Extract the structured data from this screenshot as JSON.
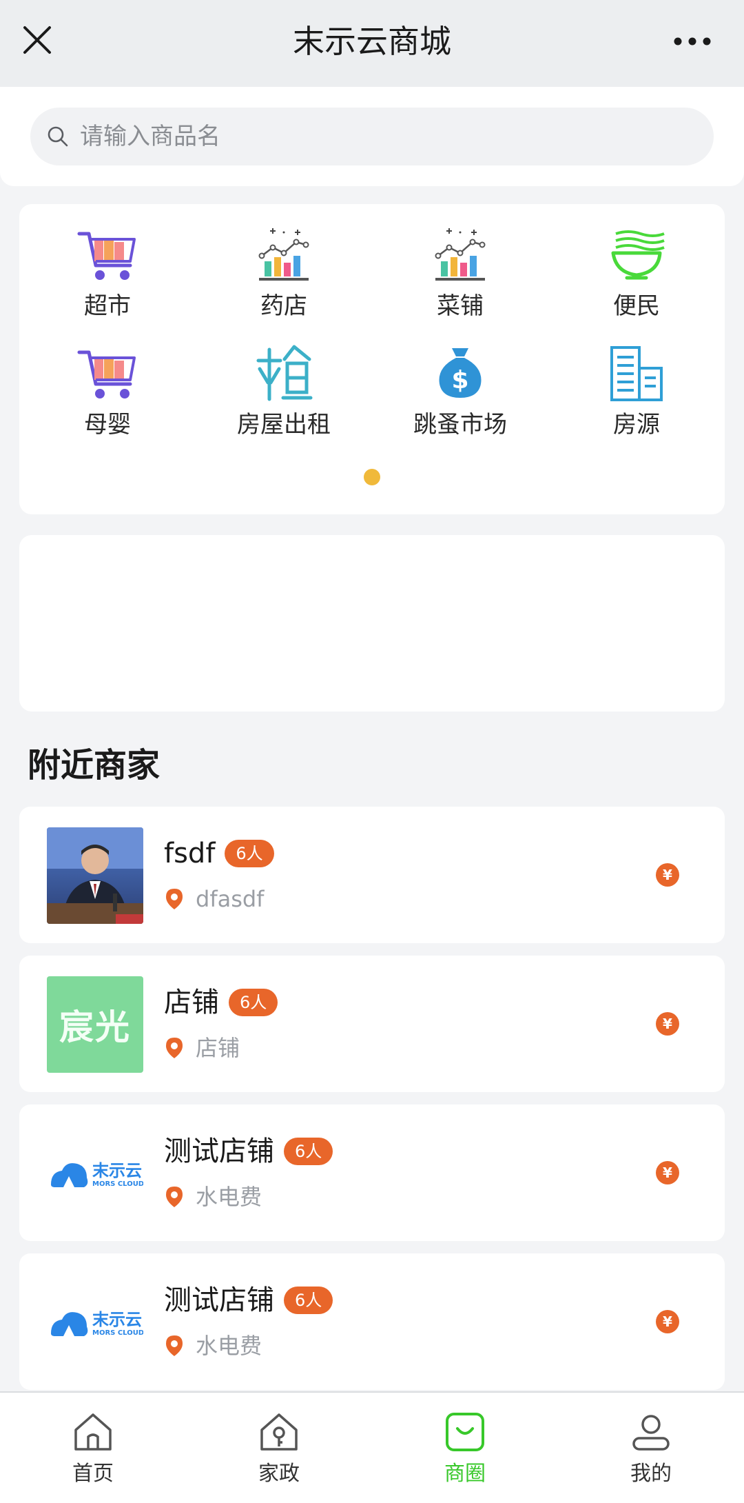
{
  "app": {
    "title": "末示云商城"
  },
  "search": {
    "placeholder": "请输入商品名",
    "value": ""
  },
  "categories": [
    {
      "label": "超市",
      "icon": "shopping-cart-icon"
    },
    {
      "label": "药店",
      "icon": "bar-chart-icon"
    },
    {
      "label": "菜铺",
      "icon": "bar-chart-icon"
    },
    {
      "label": "便民",
      "icon": "noodle-bowl-icon"
    },
    {
      "label": "母婴",
      "icon": "shopping-cart-icon"
    },
    {
      "label": "房屋出租",
      "icon": "rent-icon"
    },
    {
      "label": "跳蚤市场",
      "icon": "money-bag-icon"
    },
    {
      "label": "房源",
      "icon": "buildings-icon"
    }
  ],
  "carousel": {
    "active_page": 1,
    "page_count": 1,
    "dot_color": "#f0b93a"
  },
  "nearby": {
    "title": "附近商家",
    "shops": [
      {
        "name": "fsdf",
        "badge": "6人",
        "address": "dfasdf",
        "thumb": "portrait-photo",
        "price_icon": "¥"
      },
      {
        "name": "店铺",
        "badge": "6人",
        "address": "店铺",
        "thumb": "text-logo",
        "thumb_text": "宸光",
        "price_icon": "¥"
      },
      {
        "name": "测试店铺",
        "badge": "6人",
        "address": "水电费",
        "thumb": "mars-cloud-logo",
        "logo_text": "末示云",
        "logo_sub": "MORS CLOUD",
        "price_icon": "¥"
      },
      {
        "name": "测试店铺",
        "badge": "6人",
        "address": "水电费",
        "thumb": "mars-cloud-logo",
        "logo_text": "末示云",
        "logo_sub": "MORS CLOUD",
        "price_icon": "¥"
      }
    ]
  },
  "tabbar": {
    "active": 2,
    "tabs": [
      {
        "label": "首页",
        "icon": "home-icon"
      },
      {
        "label": "家政",
        "icon": "house-key-icon"
      },
      {
        "label": "商圈",
        "icon": "shopping-bag-icon"
      },
      {
        "label": "我的",
        "icon": "user-icon"
      }
    ]
  },
  "colors": {
    "accent": "#38c82a",
    "badge": "#e8662a",
    "background": "#f3f4f6"
  }
}
